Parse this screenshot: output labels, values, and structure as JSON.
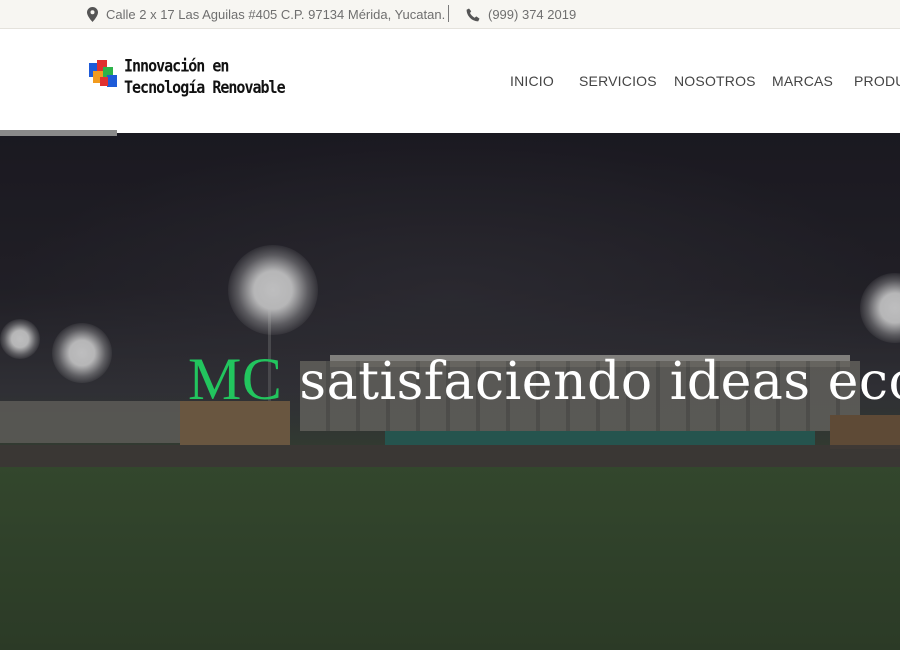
{
  "topbar": {
    "address": "Calle 2 x 17 Las Aguilas #405 C.P. 97134 Mérida, Yucatan.",
    "phone": "(999) 374 2019"
  },
  "brand": {
    "line1": "Innovación en",
    "line2": "Tecnología Renovable"
  },
  "nav": {
    "items": [
      {
        "label": "INICIO"
      },
      {
        "label": "SERVICIOS"
      },
      {
        "label": "NOSOTROS"
      },
      {
        "label": "MARCAS"
      },
      {
        "label": "PRODU"
      }
    ]
  },
  "hero": {
    "accent": "MC",
    "headline": "satisfaciendo ideas eco"
  },
  "colors": {
    "accent_green": "#22c55e",
    "topbar_bg": "#f7f6f2",
    "nav_text": "#444444"
  },
  "icons": {
    "address": "map-marker-icon",
    "phone": "phone-icon"
  }
}
